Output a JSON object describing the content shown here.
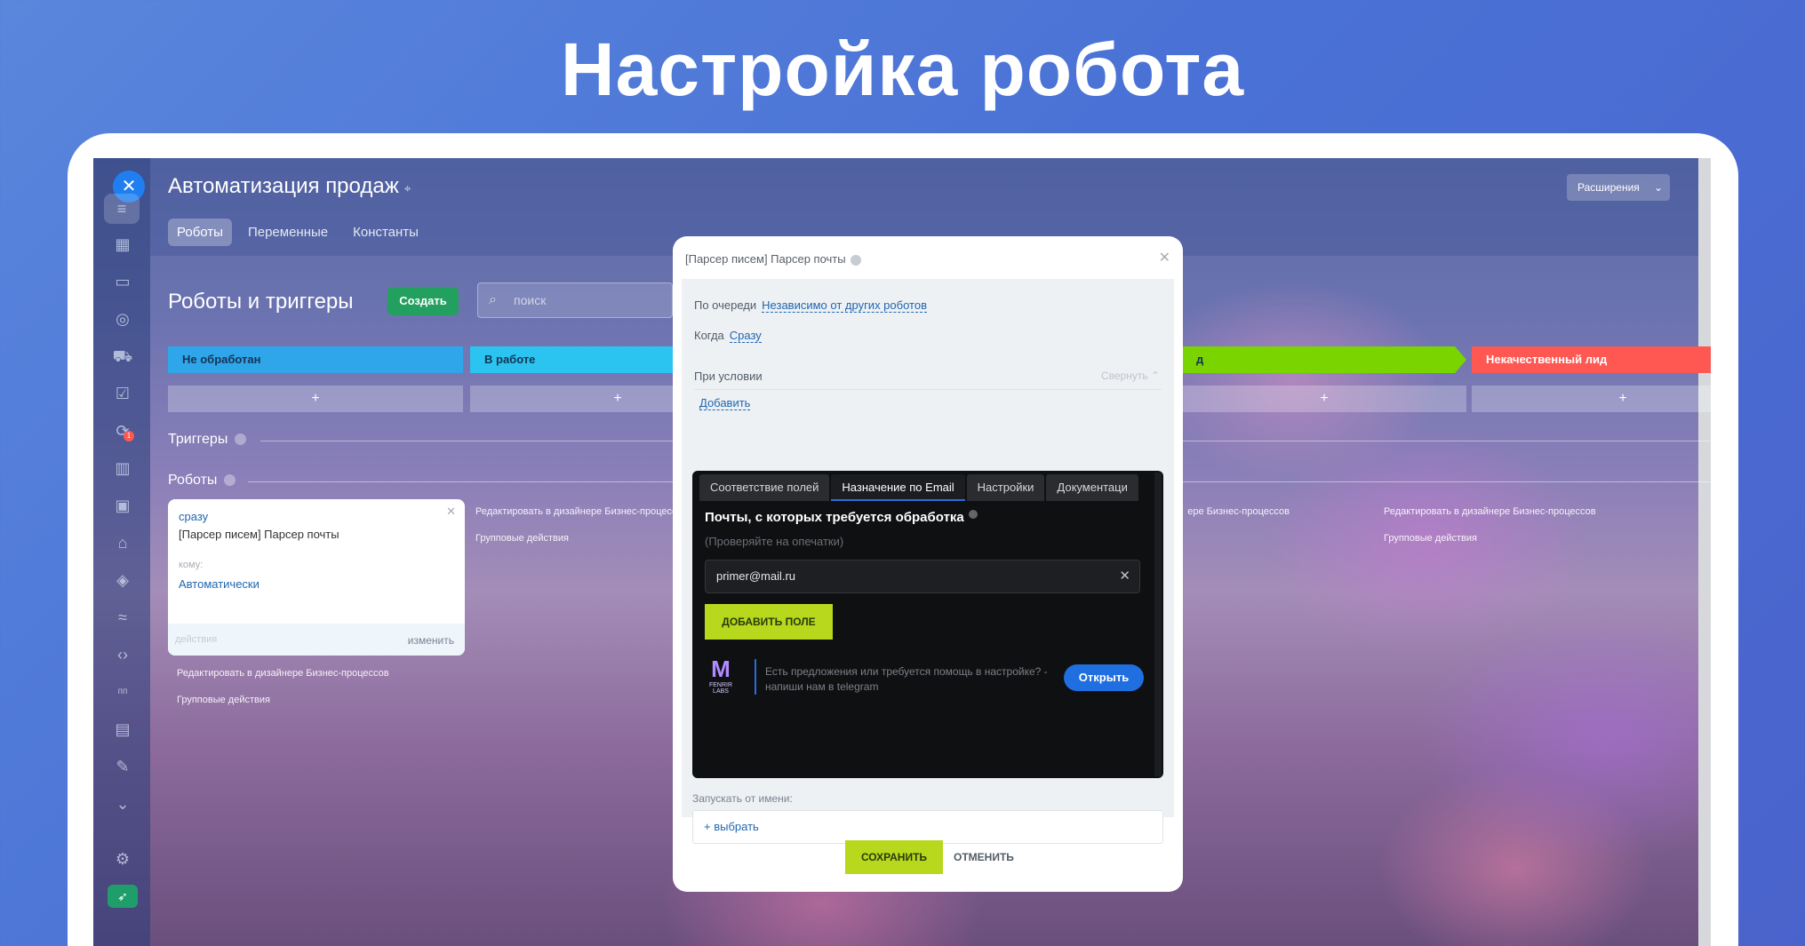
{
  "hero": {
    "title": "Настройка робота"
  },
  "app": {
    "title": "Автоматизация продаж",
    "tabs": [
      "Роботы",
      "Переменные",
      "Константы"
    ],
    "extensions_label": "Расширения",
    "sidebar_badge": "1",
    "sidebar_text": "пп"
  },
  "section": {
    "title": "Роботы и триггеры",
    "create_label": "Создать",
    "search_placeholder": "поиск"
  },
  "stages": [
    {
      "label": "Не обработан",
      "color": "#2fa6ea"
    },
    {
      "label": "В работе",
      "color": "#2bc4f0"
    },
    {
      "label": "д",
      "color": "#79d400"
    },
    {
      "label": "Некачественный лид",
      "color": "#ff5752"
    }
  ],
  "plus_label": "+",
  "triggers_label": "Триггеры",
  "robots_label": "Роботы",
  "robot_card": {
    "when": "сразу",
    "name": "[Парсер писем] Парсер почты",
    "to_label": "кому:",
    "to_value": "Автоматически",
    "actions": "действия",
    "edit": "изменить"
  },
  "links": {
    "edit_designer": "Редактировать в дизайнере Бизнес-процессов",
    "group_actions": "Групповые действия"
  },
  "modal": {
    "title": "[Парсер писем] Парсер почты",
    "queue_label": "По очереди",
    "queue_value": "Независимо от других роботов",
    "when_label": "Когда",
    "when_value": "Сразу",
    "condition_label": "При условии",
    "collapse_label": "Свернуть",
    "add_label": "Добавить",
    "panel": {
      "tabs": [
        "Соответствие полей",
        "Назначение по Email",
        "Настройки",
        "Документаци"
      ],
      "active_tab": 1,
      "heading": "Почты, с которых требуется обработка",
      "subheading": "(Проверяйте на опечатки)",
      "email_value": "primer@mail.ru",
      "add_field": "ДОБАВИТЬ ПОЛЕ",
      "logo_text": "FENRIR LABS",
      "help_text": "Есть предложения или требуется помощь в настройке? - напиши нам в telegram",
      "open_label": "Открыть"
    },
    "run_as_label": "Запускать от имени:",
    "select_label": "+ выбрать",
    "save_label": "СОХРАНИТЬ",
    "cancel_label": "ОТМЕНИТЬ"
  }
}
